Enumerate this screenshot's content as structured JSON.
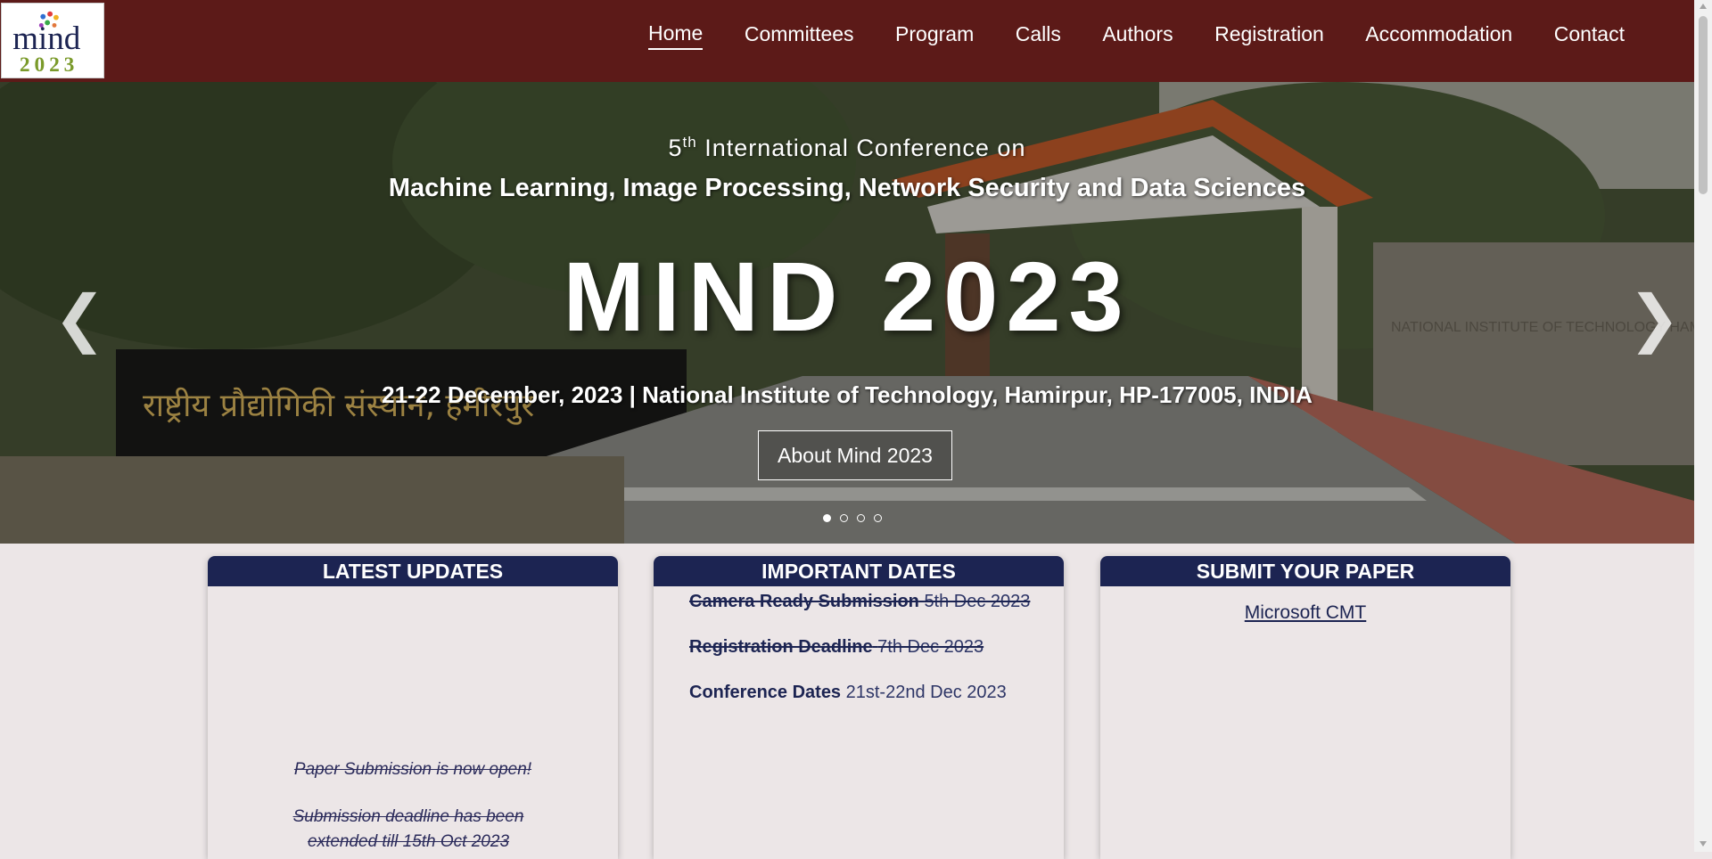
{
  "logo": {
    "text_top": "mind",
    "text_bottom": "2023",
    "colors": {
      "mind": "#1c2452",
      "year": "#7a9a2a"
    }
  },
  "nav": {
    "items": [
      {
        "label": "Home",
        "active": true
      },
      {
        "label": "Committees"
      },
      {
        "label": "Program"
      },
      {
        "label": "Calls"
      },
      {
        "label": "Authors"
      },
      {
        "label": "Registration"
      },
      {
        "label": "Accommodation"
      },
      {
        "label": "Contact"
      }
    ]
  },
  "hero": {
    "ordinal_number": "5",
    "ordinal_suffix": "th",
    "subtitle_rest": " International Conference on",
    "theme": "Machine Learning, Image Processing, Network Security and Data Sciences",
    "title": "MIND 2023",
    "venue": "21-22 December, 2023 | National Institute of Technology, Hamirpur, HP-177005, INDIA",
    "button_label": "About Mind 2023",
    "prev_arrow": "❮",
    "next_arrow": "❯",
    "slide_count": 4,
    "active_slide": 1,
    "sign_text": "राष्ट्रीय प्रौद्योगिकी संस्थान, हमीरपुर",
    "gate_text": "NATIONAL INSTITUTE OF TECHNOLOGY HAMIRPUR"
  },
  "cards": {
    "updates": {
      "title": "LATEST UPDATES",
      "items": [
        "Paper Submission is now open!",
        "Submission deadline has been extended till 15th Oct 2023"
      ]
    },
    "dates": {
      "title": "IMPORTANT DATES",
      "rows": [
        {
          "label": "Camera Ready Submission",
          "value": "5th Dec 2023",
          "struck": true
        },
        {
          "label": "Registration Deadline",
          "value": "7th Dec 2023",
          "struck": true
        },
        {
          "label": "Conference Dates",
          "value": "21st-22nd Dec 2023",
          "struck": false
        }
      ]
    },
    "submit": {
      "title": "SUBMIT YOUR PAPER",
      "link_label": "Microsoft CMT"
    }
  },
  "theme_colors": {
    "navbar": "#5c1a18",
    "card_header": "#1c2452",
    "page_bg": "#ece6e7"
  }
}
